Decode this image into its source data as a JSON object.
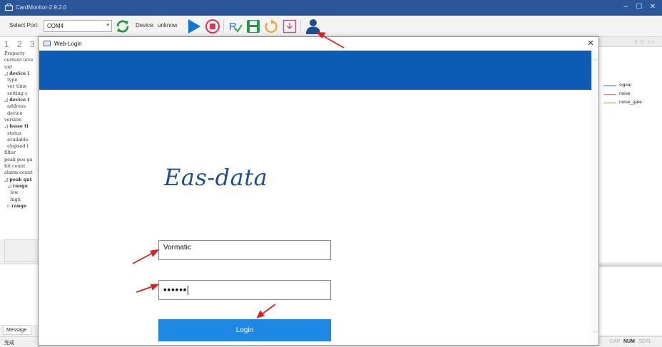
{
  "window": {
    "title": "CardMonitor-2.9.2.0",
    "controls": [
      "–",
      "☐",
      "✕"
    ]
  },
  "toolbar": {
    "port_label": "Select Port:",
    "port_value": "COM4",
    "device_label": "Device:",
    "device_value": "unknow",
    "buttons": [
      "refresh-icon",
      "play-icon",
      "stop-icon",
      "verify-icon",
      "save-icon",
      "reset-icon",
      "download-icon",
      "user-icon"
    ]
  },
  "left_panel": {
    "page_tabs": "1 2 3",
    "tree": [
      {
        "text": "Property",
        "bold": false
      },
      {
        "text": "current leve",
        "bold": false
      },
      {
        "text": "uid",
        "bold": false
      },
      {
        "text": "◿ device i",
        "bold": true
      },
      {
        "text": "  type",
        "bold": false
      },
      {
        "text": "  ver time",
        "bold": false
      },
      {
        "text": "  setting c",
        "bold": false
      },
      {
        "text": "◿ device t",
        "bold": true
      },
      {
        "text": "  address",
        "bold": false
      },
      {
        "text": "  device",
        "bold": false
      },
      {
        "text": "version",
        "bold": false
      },
      {
        "text": "◿ lease ti",
        "bold": true
      },
      {
        "text": "  status",
        "bold": false
      },
      {
        "text": "  available",
        "bold": false
      },
      {
        "text": "  elapsed t",
        "bold": false
      },
      {
        "text": "filter",
        "bold": false
      },
      {
        "text": "peak pos ga",
        "bold": false
      },
      {
        "text": "hit count",
        "bold": false
      },
      {
        "text": "alarm count",
        "bold": false
      },
      {
        "text": "◿ peak gat",
        "bold": true
      },
      {
        "text": "  ◿ range",
        "bold": true
      },
      {
        "text": "    low",
        "bold": false
      },
      {
        "text": "    high",
        "bold": false
      },
      {
        "text": "  ▹ range",
        "bold": true
      }
    ],
    "message_tab": "Message"
  },
  "right_panel": {
    "legend": [
      {
        "name": "signal",
        "color": "#3a6fc4"
      },
      {
        "name": "noise",
        "color": "#e58080"
      },
      {
        "name": "noise_gate",
        "color": "#9e8f5a"
      }
    ]
  },
  "statusbar": {
    "left": "完成",
    "indicators": [
      {
        "text": "CAP",
        "on": false
      },
      {
        "text": "NUM",
        "on": true
      },
      {
        "text": "SCRL",
        "on": false
      }
    ]
  },
  "dialog": {
    "title": "Web-Login",
    "close": "✕",
    "brand": "Eas-data",
    "username": "Vormatic",
    "password_mask": "••••••",
    "login_label": "Login",
    "banner_color": "#0c5bb5",
    "button_color": "#1e88e5"
  },
  "annotation_color": "#e02020"
}
